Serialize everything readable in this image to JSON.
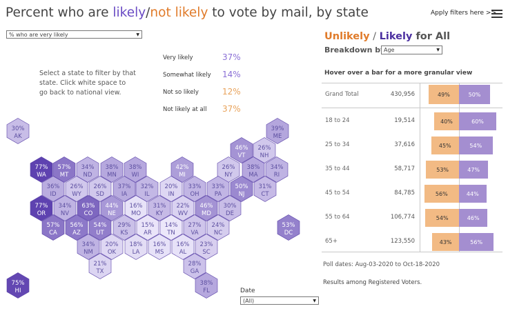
{
  "header": {
    "title_part1": "Percent who are ",
    "title_likely": "likely",
    "title_slash": "/",
    "title_not_likely": "not likely",
    "title_part2": " to vote by mail, by state",
    "apply_filters": "Apply filters here >>",
    "menu_icon": "hamburger-menu-icon"
  },
  "filters": {
    "measure_value": "% who are very likely",
    "date_label": "Date",
    "date_value": "(All)"
  },
  "instructions": "Select a state to filter by that state. Click white space to go back to national view.",
  "summary": [
    {
      "label": "Very likely",
      "value": "37%",
      "color": "#8a6fd6"
    },
    {
      "label": "Somewhat likely",
      "value": "14%",
      "color": "#8a6fd6"
    },
    {
      "label": "Not so likely",
      "value": "12%",
      "color": "#e8a25a"
    },
    {
      "label": "Not likely at all",
      "value": "37%",
      "color": "#e8a25a"
    }
  ],
  "map_states": [
    {
      "abbr": "AK",
      "pct": "30%",
      "v": 30
    },
    {
      "abbr": "ME",
      "pct": "39%",
      "v": 39
    },
    {
      "abbr": "VT",
      "pct": "46%",
      "v": 46
    },
    {
      "abbr": "NH",
      "pct": "26%",
      "v": 26
    },
    {
      "abbr": "WA",
      "pct": "77%",
      "v": 77
    },
    {
      "abbr": "MT",
      "pct": "57%",
      "v": 57
    },
    {
      "abbr": "ND",
      "pct": "34%",
      "v": 34
    },
    {
      "abbr": "MN",
      "pct": "38%",
      "v": 38
    },
    {
      "abbr": "WI",
      "pct": "38%",
      "v": 38
    },
    {
      "abbr": "MI",
      "pct": "42%",
      "v": 42
    },
    {
      "abbr": "NY",
      "pct": "26%",
      "v": 26
    },
    {
      "abbr": "MA",
      "pct": "38%",
      "v": 38
    },
    {
      "abbr": "RI",
      "pct": "34%",
      "v": 34
    },
    {
      "abbr": "ID",
      "pct": "36%",
      "v": 36
    },
    {
      "abbr": "WY",
      "pct": "26%",
      "v": 26
    },
    {
      "abbr": "SD",
      "pct": "26%",
      "v": 26
    },
    {
      "abbr": "IA",
      "pct": "37%",
      "v": 37
    },
    {
      "abbr": "IL",
      "pct": "32%",
      "v": 32
    },
    {
      "abbr": "IN",
      "pct": "20%",
      "v": 20
    },
    {
      "abbr": "OH",
      "pct": "33%",
      "v": 33
    },
    {
      "abbr": "PA",
      "pct": "33%",
      "v": 33
    },
    {
      "abbr": "NJ",
      "pct": "50%",
      "v": 50
    },
    {
      "abbr": "CT",
      "pct": "31%",
      "v": 31
    },
    {
      "abbr": "OR",
      "pct": "77%",
      "v": 77
    },
    {
      "abbr": "NV",
      "pct": "34%",
      "v": 34
    },
    {
      "abbr": "CO",
      "pct": "63%",
      "v": 63
    },
    {
      "abbr": "NE",
      "pct": "44%",
      "v": 44
    },
    {
      "abbr": "MO",
      "pct": "16%",
      "v": 16
    },
    {
      "abbr": "KY",
      "pct": "31%",
      "v": 31
    },
    {
      "abbr": "WV",
      "pct": "22%",
      "v": 22
    },
    {
      "abbr": "MD",
      "pct": "46%",
      "v": 46
    },
    {
      "abbr": "DE",
      "pct": "30%",
      "v": 30
    },
    {
      "abbr": "CA",
      "pct": "57%",
      "v": 57
    },
    {
      "abbr": "AZ",
      "pct": "56%",
      "v": 56
    },
    {
      "abbr": "UT",
      "pct": "54%",
      "v": 54
    },
    {
      "abbr": "KS",
      "pct": "29%",
      "v": 29
    },
    {
      "abbr": "AR",
      "pct": "15%",
      "v": 15
    },
    {
      "abbr": "TN",
      "pct": "14%",
      "v": 14
    },
    {
      "abbr": "VA",
      "pct": "27%",
      "v": 27
    },
    {
      "abbr": "NC",
      "pct": "24%",
      "v": 24
    },
    {
      "abbr": "DC",
      "pct": "53%",
      "v": 53
    },
    {
      "abbr": "NM",
      "pct": "34%",
      "v": 34
    },
    {
      "abbr": "OK",
      "pct": "20%",
      "v": 20
    },
    {
      "abbr": "LA",
      "pct": "18%",
      "v": 18
    },
    {
      "abbr": "MS",
      "pct": "16%",
      "v": 16
    },
    {
      "abbr": "AL",
      "pct": "16%",
      "v": 16
    },
    {
      "abbr": "SC",
      "pct": "23%",
      "v": 23
    },
    {
      "abbr": "TX",
      "pct": "21%",
      "v": 21
    },
    {
      "abbr": "GA",
      "pct": "28%",
      "v": 28
    },
    {
      "abbr": "HI",
      "pct": "75%",
      "v": 75
    },
    {
      "abbr": "FL",
      "pct": "38%",
      "v": 38
    }
  ],
  "right_panel": {
    "title_unlikely": "Unlikely",
    "title_slash": " / ",
    "title_likely": "Likely",
    "title_for_all": " for All",
    "breakdown_label": "Breakdown by",
    "breakdown_value": "Age",
    "hover_note": "Hover over a bar for a more granular view",
    "rows": [
      {
        "label": "Grand Total",
        "count": "430,956",
        "unlikely": "49%",
        "likely": "50%",
        "u": 49,
        "l": 50
      },
      {
        "label": "18 to 24",
        "count": "19,514",
        "unlikely": "40%",
        "likely": "60%",
        "u": 40,
        "l": 60
      },
      {
        "label": "25 to 34",
        "count": "37,616",
        "unlikely": "45%",
        "likely": "54%",
        "u": 45,
        "l": 54
      },
      {
        "label": "35 to 44",
        "count": "58,717",
        "unlikely": "53%",
        "likely": "47%",
        "u": 53,
        "l": 47
      },
      {
        "label": "45 to 54",
        "count": "84,785",
        "unlikely": "56%",
        "likely": "44%",
        "u": 56,
        "l": 44
      },
      {
        "label": "55 to 64",
        "count": "106,774",
        "unlikely": "54%",
        "likely": "46%",
        "u": 54,
        "l": 46
      },
      {
        "label": "65+",
        "count": "123,550",
        "unlikely": "43%",
        "likely": "56%",
        "u": 43,
        "l": 56
      }
    ],
    "poll_dates": "Poll dates: Aug-03-2020 to Oct-18-2020",
    "results_note": "Results among Registered Voters."
  }
}
